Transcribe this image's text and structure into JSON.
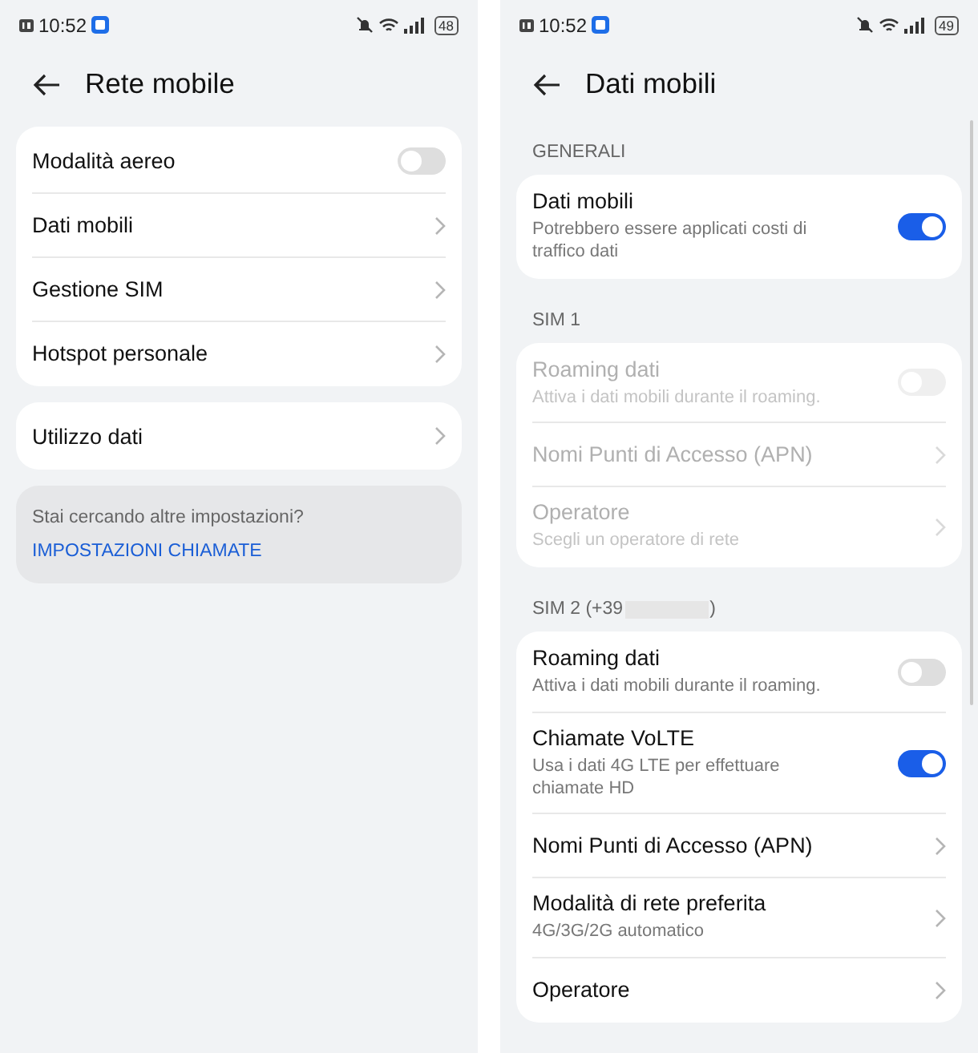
{
  "screens": [
    {
      "status_bar": {
        "time": "10:52",
        "battery": "48"
      },
      "title": "Rete mobile",
      "scrollbar": false,
      "sections": [
        {
          "rows": [
            {
              "kind": "toggle",
              "title": "Modalità aereo",
              "on": false,
              "disabled": false
            },
            {
              "kind": "link",
              "title": "Dati mobili",
              "disabled": false
            },
            {
              "kind": "link",
              "title": "Gestione SIM",
              "disabled": false
            },
            {
              "kind": "link",
              "title": "Hotspot personale",
              "disabled": false
            }
          ]
        },
        {
          "rows": [
            {
              "kind": "link",
              "title": "Utilizzo dati",
              "disabled": false
            }
          ]
        }
      ],
      "hint": {
        "text": "Stai cercando altre impostazioni?",
        "link": "IMPOSTAZIONI CHIAMATE"
      }
    },
    {
      "status_bar": {
        "time": "10:52",
        "battery": "49"
      },
      "title": "Dati mobili",
      "scrollbar": true,
      "sections": [
        {
          "header": "GENERALI",
          "rows": [
            {
              "kind": "toggle",
              "title": "Dati mobili",
              "subtitle": "Potrebbero essere applicati costi di traffico dati",
              "on": true,
              "disabled": false
            }
          ]
        },
        {
          "header": "SIM 1",
          "rows": [
            {
              "kind": "toggle",
              "title": "Roaming dati",
              "subtitle": "Attiva i dati mobili durante il roaming.",
              "on": false,
              "disabled": true
            },
            {
              "kind": "link",
              "title": "Nomi Punti di Accesso (APN)",
              "disabled": true
            },
            {
              "kind": "link",
              "title": "Operatore",
              "subtitle": "Scegli un operatore di rete",
              "disabled": true
            }
          ]
        },
        {
          "header": "SIM 2 (+39",
          "header_end": ")",
          "rows": [
            {
              "kind": "toggle",
              "title": "Roaming dati",
              "subtitle": "Attiva i dati mobili durante il roaming.",
              "on": false,
              "disabled": false
            },
            {
              "kind": "toggle",
              "title": "Chiamate VoLTE",
              "subtitle": "Usa i dati 4G LTE per effettuare chiamate HD",
              "on": true,
              "disabled": false
            },
            {
              "kind": "link",
              "title": "Nomi Punti di Accesso (APN)",
              "disabled": false
            },
            {
              "kind": "link",
              "title": "Modalità di rete preferita",
              "subtitle": "4G/3G/2G automatico",
              "disabled": false
            },
            {
              "kind": "link",
              "title": "Operatore",
              "disabled": false
            }
          ]
        }
      ]
    }
  ]
}
